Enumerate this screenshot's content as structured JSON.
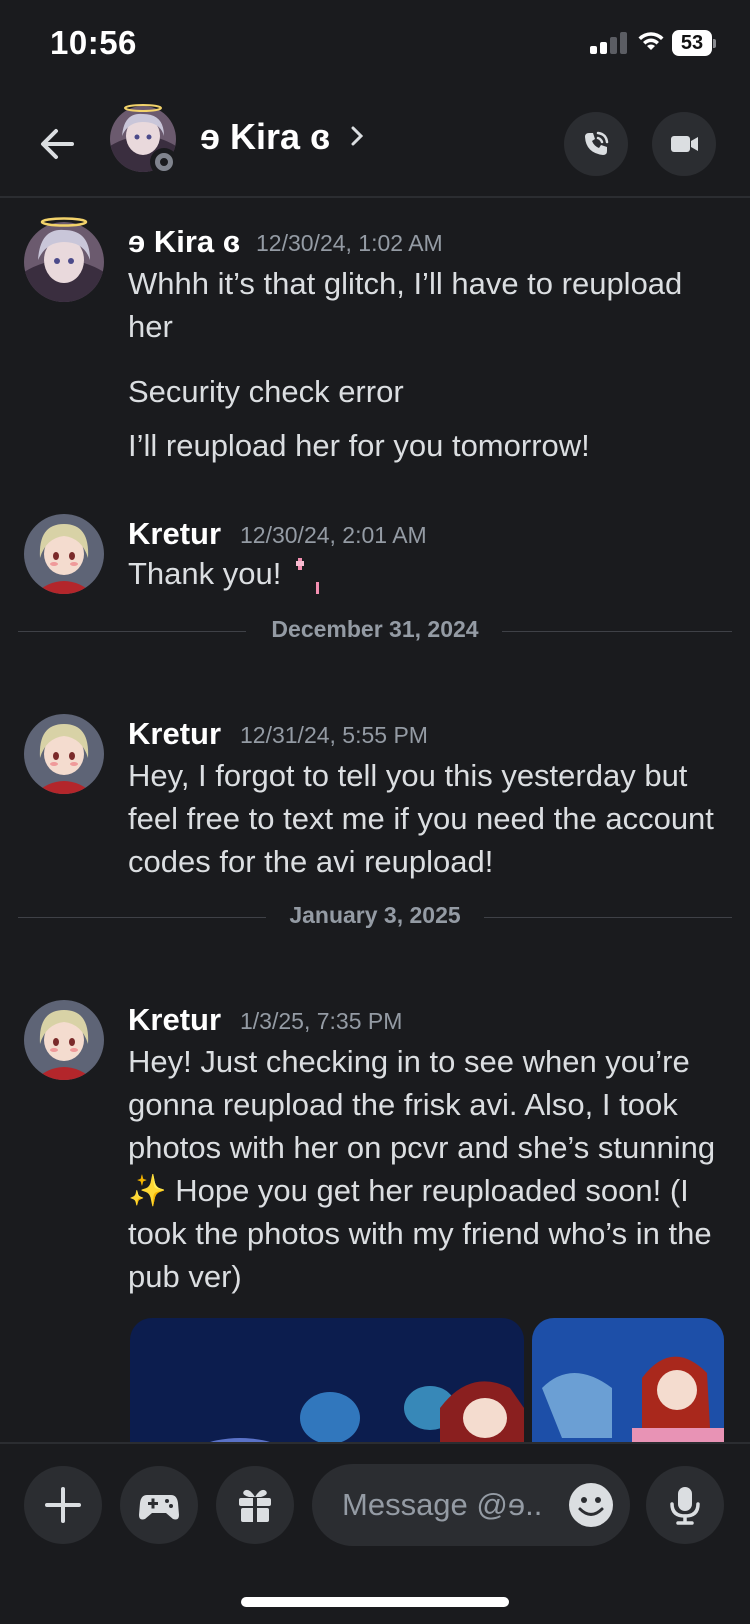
{
  "status_bar": {
    "time": "10:56",
    "battery": "53",
    "icons": [
      "signal-icon",
      "wifi-icon",
      "battery-icon"
    ]
  },
  "header": {
    "title": "ɘ Kira ɞ",
    "icons": [
      "back-arrow-icon",
      "chevron-right-icon",
      "phone-call-icon",
      "video-camera-icon"
    ]
  },
  "messages": [
    {
      "author": "ɘ Kira ɞ",
      "time": "12/30/24, 1:02 AM",
      "lines": [
        "Whhh it’s that glitch, I’ll have to reupload her",
        "Security check error",
        "I’ll reupload her for you tomorrow!"
      ]
    },
    {
      "author": "Kretur",
      "time": "12/30/24, 2:01 AM",
      "lines": [
        "Thank you!"
      ]
    },
    {
      "author": "Kretur",
      "time": "12/31/24, 5:55 PM",
      "lines": [
        "Hey, I forgot to tell you this yesterday but feel free to text me if you need the account codes for the avi reupload!"
      ]
    },
    {
      "author": "Kretur",
      "time": "1/3/25, 7:35 PM",
      "lines": [
        "Hey! Just checking in to see when you’re gonna reupload the frisk avi. Also, I took photos with her on pcvr and she’s stunning ✨ Hope you get her reuploaded soon! (I took the photos with my friend who’s in the pub ver)"
      ]
    }
  ],
  "dividers": [
    "December 31, 2024",
    "January 3, 2025"
  ],
  "composer": {
    "placeholder": "Message @ɘ...",
    "icons": [
      "plus-icon",
      "gamepad-icon",
      "gift-icon",
      "emoji-icon",
      "microphone-icon"
    ]
  },
  "colors": {
    "background": "#1a1b1e",
    "surface": "#2b2d31",
    "text": "#dbdee1",
    "muted": "#949ba4"
  }
}
